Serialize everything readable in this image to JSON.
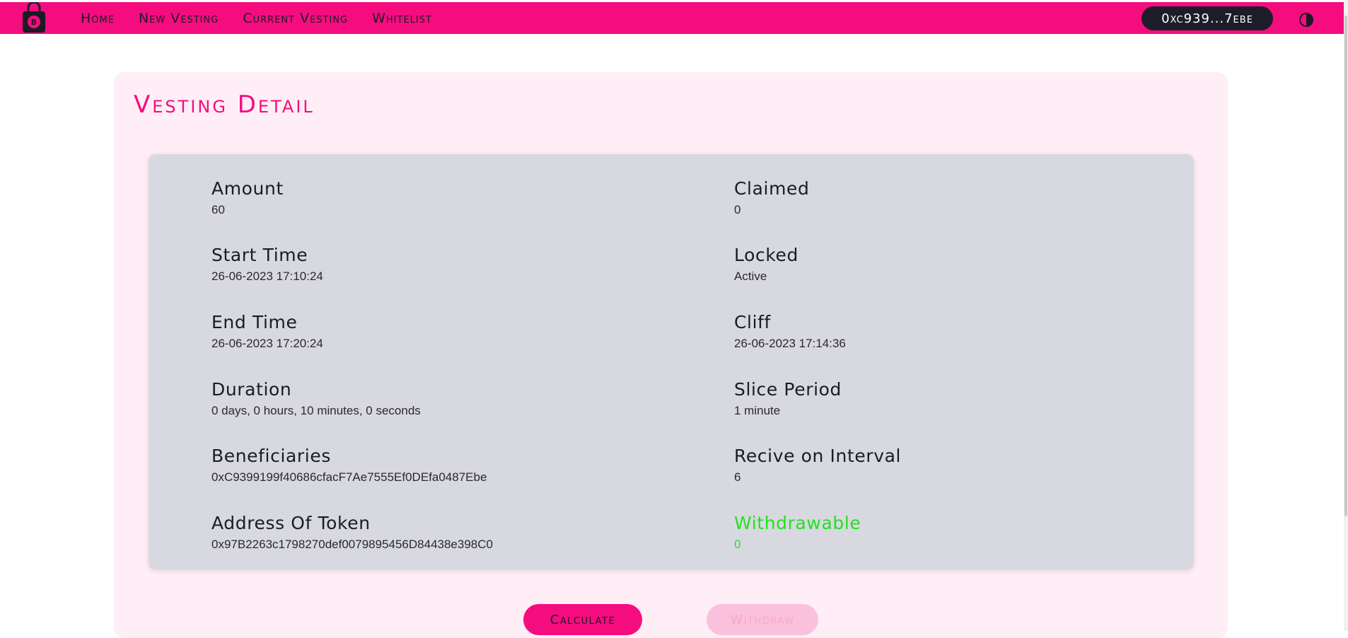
{
  "nav": {
    "items": [
      "Home",
      "New Vesting",
      "Current Vesting",
      "Whitelist"
    ]
  },
  "wallet": {
    "address": "0xc939...7ebe"
  },
  "icons": {
    "logo": "bitcoin-lock-icon",
    "theme": "contrast-toggle-icon"
  },
  "colors": {
    "accent": "#f50c7f",
    "panel": "#ffeef5",
    "card": "#d8d8e0",
    "positive": "#1fe31f"
  },
  "page": {
    "title": "Vesting Detail"
  },
  "details": {
    "amount": {
      "label": "Amount",
      "value": "60"
    },
    "claimed": {
      "label": "Claimed",
      "value": "0"
    },
    "start_time": {
      "label": "Start Time",
      "value": "26-06-2023 17:10:24"
    },
    "locked": {
      "label": "Locked",
      "value": "Active"
    },
    "end_time": {
      "label": "End Time",
      "value": "26-06-2023 17:20:24"
    },
    "cliff": {
      "label": "Cliff",
      "value": "26-06-2023 17:14:36"
    },
    "duration": {
      "label": "Duration",
      "value": "0 days, 0 hours, 10 minutes, 0 seconds"
    },
    "slice_period": {
      "label": "Slice Period",
      "value": "1 minute"
    },
    "beneficiaries": {
      "label": "Beneficiaries",
      "value": "0xC9399199f40686cfacF7Ae7555Ef0DEfa0487Ebe"
    },
    "receive_interval": {
      "label": "Recive on Interval",
      "value": "6"
    },
    "token_address": {
      "label": "Address Of Token",
      "value": "0x97B2263c1798270def0079895456D84438e398C0"
    },
    "withdrawable": {
      "label": "Withdrawable",
      "value": "0"
    }
  },
  "actions": {
    "calculate": "Calculate",
    "withdraw": "Withdraw"
  }
}
